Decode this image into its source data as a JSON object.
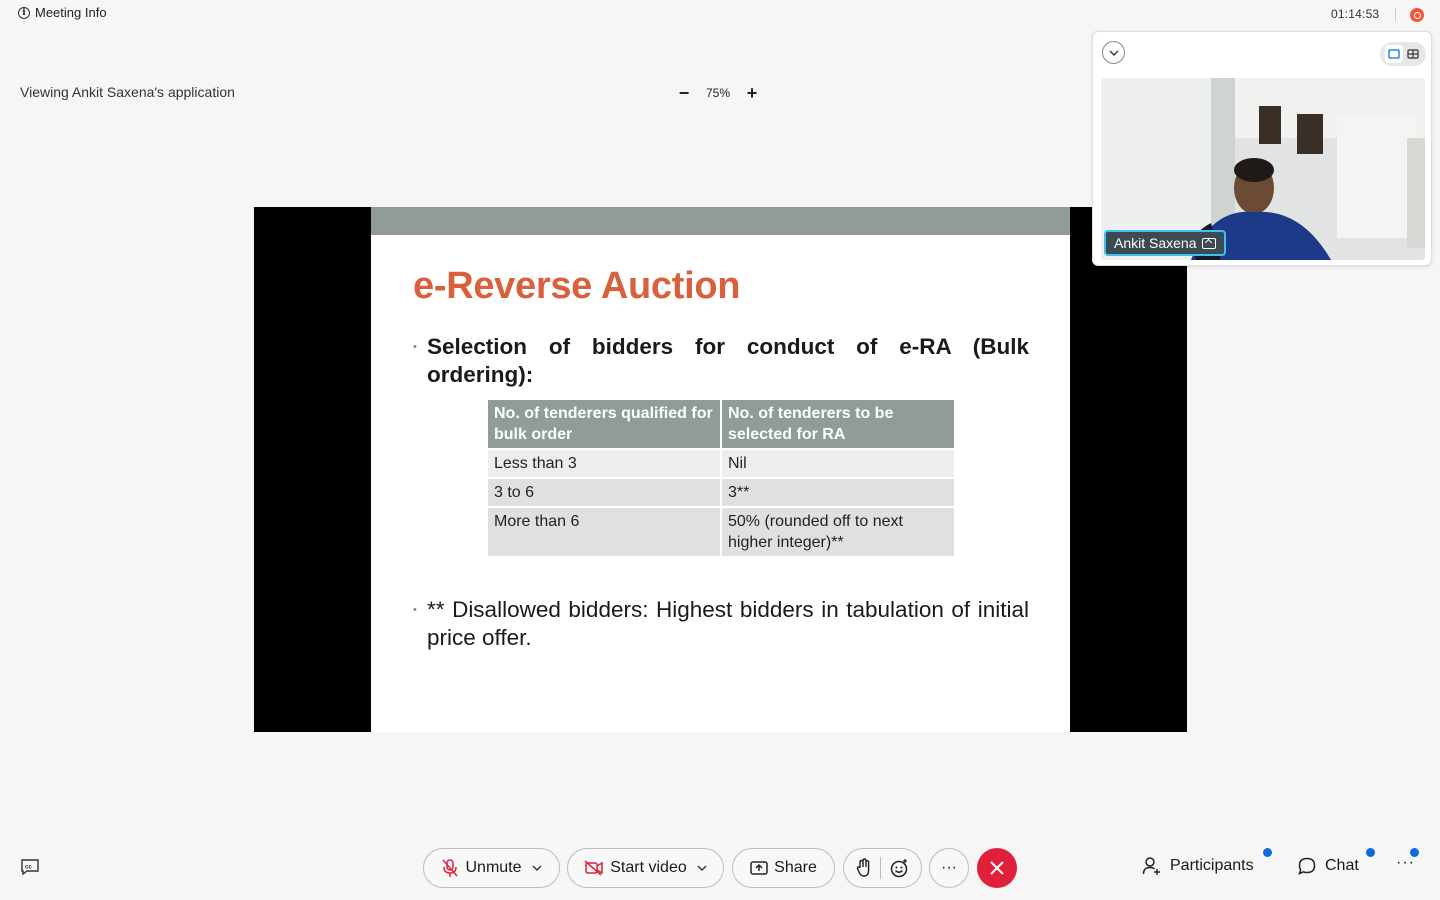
{
  "header": {
    "meeting_info_label": "Meeting Info",
    "timer": "01:14:53",
    "viewing_label": "Viewing Ankit Saxena's application"
  },
  "zoom": {
    "minus": "−",
    "level": "75%",
    "plus": "+"
  },
  "slide": {
    "title": "e-Reverse Auction",
    "bullet1": "Selection of bidders for conduct of e-RA (Bulk ordering):",
    "table": {
      "headers": [
        "No. of tenderers qualified for bulk order",
        "No. of tenderers to be selected for RA"
      ],
      "rows": [
        [
          "Less than 3",
          "Nil"
        ],
        [
          "3 to 6",
          "3**"
        ],
        [
          "More than 6",
          "50% (rounded off to next higher integer)**"
        ]
      ]
    },
    "bullet2": "** Disallowed bidders: Highest bidders in tabulation of initial price offer."
  },
  "video": {
    "participant_name": "Ankit Saxena"
  },
  "controls": {
    "unmute_label": "Unmute",
    "start_video_label": "Start video",
    "share_label": "Share",
    "more_label": "···",
    "participants_label": "Participants",
    "chat_label": "Chat",
    "overflow_label": "···"
  },
  "colors": {
    "title_orange": "#d8603d",
    "table_header": "#909c95",
    "end_call_red": "#e0203a",
    "recording_orange": "#f2573a",
    "notification_blue": "#0b6cd9"
  },
  "icons": [
    "info-icon",
    "recording-icon",
    "chevron-down-icon",
    "single-view-icon",
    "grid-view-icon",
    "share-indicator-icon",
    "closed-captions-icon",
    "mic-muted-icon",
    "video-off-icon",
    "share-screen-icon",
    "raise-hand-icon",
    "reactions-icon",
    "close-icon",
    "participants-icon",
    "chat-icon"
  ]
}
